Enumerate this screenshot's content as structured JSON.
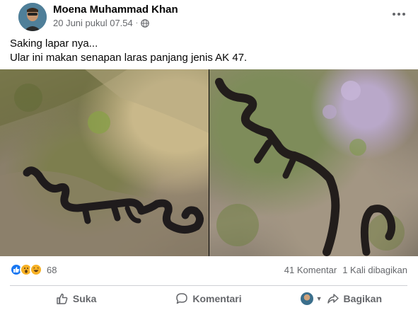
{
  "post": {
    "author": "Moena Muhammad Khan",
    "timestamp": "20 Juni pukul 07.54",
    "separator": "·",
    "privacy_icon": "globe-icon",
    "more_icon": "more-options-icon",
    "text_lines": [
      "Saking lapar nya...",
      "Ular ini makan senapan laras panjang jenis AK 47."
    ]
  },
  "stats": {
    "reaction_icons": [
      "like-icon",
      "wow-icon",
      "haha-icon"
    ],
    "reaction_count": "68",
    "comments": "41 Komentar",
    "shares": "1 Kali dibagikan"
  },
  "actions": {
    "like_label": "Suka",
    "comment_label": "Komentari",
    "share_label": "Bagikan"
  },
  "colors": {
    "text_primary": "#050505",
    "text_secondary": "#65676b",
    "like_blue": "#1877f2",
    "reaction_yellow": "#f7b125",
    "divider": "#ced0d4"
  }
}
